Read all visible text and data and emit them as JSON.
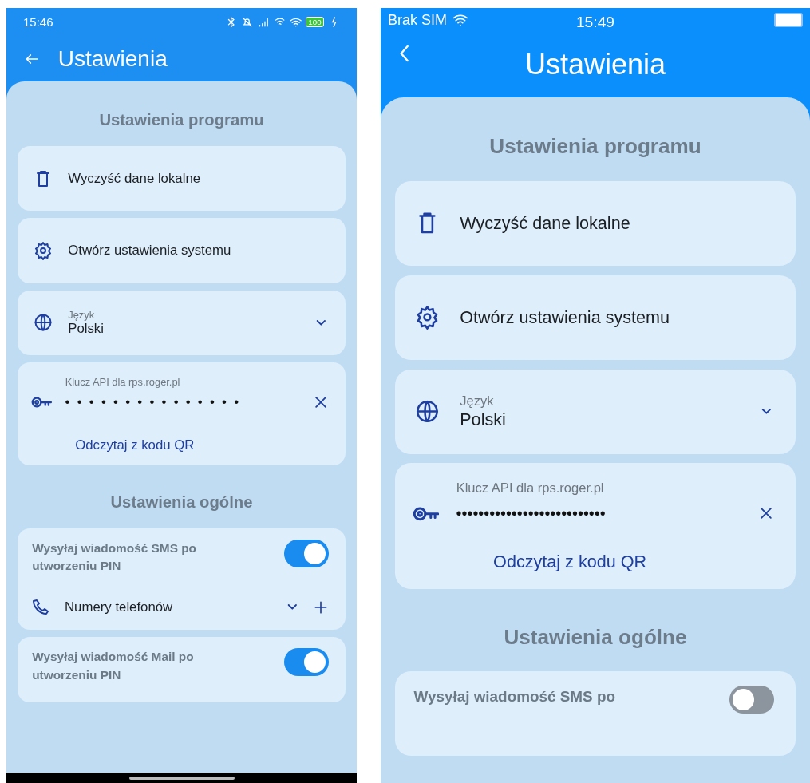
{
  "screens": [
    {
      "kind": "android",
      "status_bar": {
        "time": "15:46",
        "battery": "100"
      },
      "title": "Ustawienia",
      "sections": [
        {
          "title": "Ustawienia programu",
          "cards": [
            {
              "kind": "action",
              "label": "Wyczyść dane lokalne"
            },
            {
              "kind": "action",
              "label": "Otwórz ustawienia systemu"
            },
            {
              "kind": "dropdown",
              "label": "Język",
              "value": "Polski"
            },
            {
              "kind": "secret",
              "label": "Klucz API dla rps.roger.pl",
              "value": "•••••••••••••••",
              "link": "Odczytaj z kodu QR"
            }
          ]
        },
        {
          "title": "Ustawienia ogólne",
          "cards": [
            {
              "kind": "toggle",
              "label": "Wysyłaj wiadomość SMS po utworzeniu PIN",
              "on": true,
              "sub_row": {
                "label": "Numery telefonów"
              }
            },
            {
              "kind": "toggle",
              "label": "Wysyłaj wiadomość Mail po utworzeniu PIN",
              "on": true
            }
          ]
        }
      ]
    },
    {
      "kind": "ios",
      "status_bar": {
        "carrier": "Brak SIM",
        "time": "15:49"
      },
      "title": "Ustawienia",
      "sections": [
        {
          "title": "Ustawienia programu",
          "cards": [
            {
              "kind": "action",
              "label": "Wyczyść dane lokalne"
            },
            {
              "kind": "action",
              "label": "Otwórz ustawienia systemu"
            },
            {
              "kind": "dropdown",
              "label": "Język",
              "value": "Polski"
            },
            {
              "kind": "secret",
              "label": "Klucz API dla rps.roger.pl",
              "value": "•••••••••••••••••••••••••••",
              "link": "Odczytaj z kodu QR"
            }
          ]
        },
        {
          "title": "Ustawienia ogólne",
          "cards": [
            {
              "kind": "toggle",
              "label": "Wysyłaj wiadomość SMS po",
              "on": false
            }
          ]
        }
      ]
    }
  ]
}
